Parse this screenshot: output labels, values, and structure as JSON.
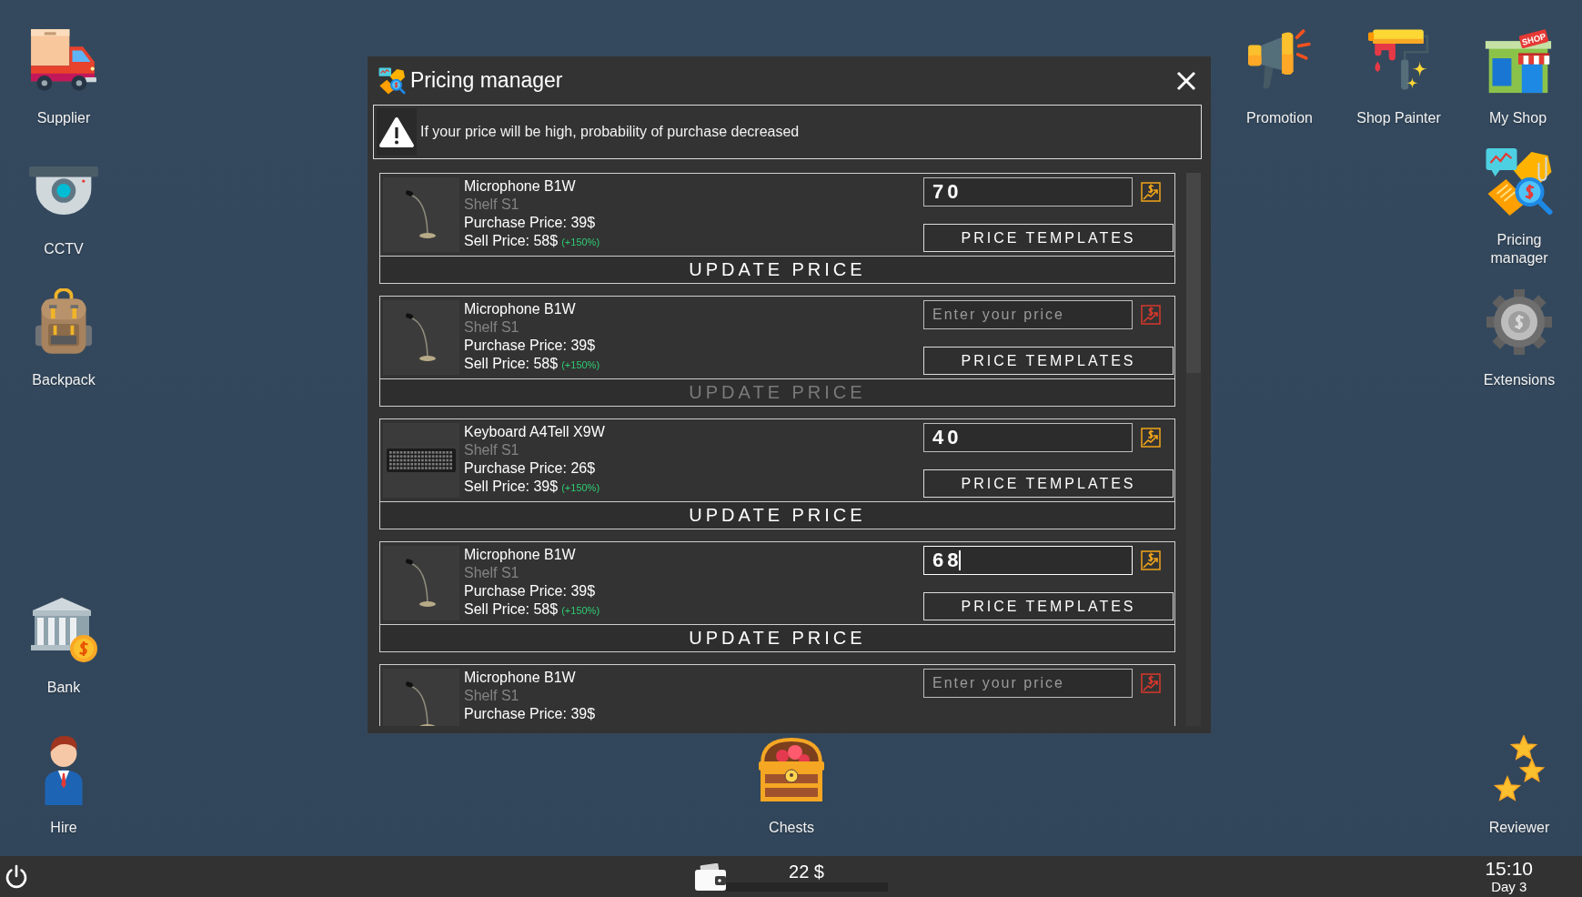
{
  "desktop": {
    "left_column": [
      {
        "label": "Supplier",
        "kind": "truck"
      },
      {
        "label": "CCTV",
        "kind": "camera"
      },
      {
        "label": "Backpack",
        "kind": "backpack"
      }
    ],
    "left_bottom": [
      {
        "label": "Bank",
        "kind": "bank"
      },
      {
        "label": "Hire",
        "kind": "person"
      }
    ],
    "top_right": [
      {
        "label": "Promotion",
        "kind": "megaphone"
      },
      {
        "label": "Shop Painter",
        "kind": "roller"
      },
      {
        "label": "My Shop",
        "kind": "shop",
        "sign": "SHOP"
      }
    ],
    "right_column": [
      {
        "label": "Pricing manager",
        "kind": "pricing"
      },
      {
        "label": "Extensions",
        "kind": "gear"
      }
    ],
    "bottom_center": [
      {
        "label": "Chests",
        "kind": "chest"
      }
    ],
    "bottom_right": [
      {
        "label": "Reviewer",
        "kind": "stars"
      }
    ]
  },
  "window": {
    "title": "Pricing manager",
    "notice": "If your price will be high, probability of purchase decreased",
    "cards": [
      {
        "product": "Microphone B1W",
        "kind": "microphone",
        "shelf": "Shelf S1",
        "purchase_price": "Purchase Price: 39$",
        "sell_price": "Sell Price: 58$",
        "markup": "(+150%)",
        "price": {
          "value": "70",
          "focused": false,
          "alert": false
        },
        "templates_button": "PRICE TEMPLATES",
        "update_button": {
          "label": "UPDATE PRICE",
          "disabled": false
        }
      },
      {
        "product": "Microphone B1W",
        "kind": "microphone",
        "shelf": "Shelf S1",
        "purchase_price": "Purchase Price: 39$",
        "sell_price": "Sell Price: 58$",
        "markup": "(+150%)",
        "price": {
          "placeholder": "Enter your price",
          "focused": false,
          "alert": true
        },
        "templates_button": "PRICE TEMPLATES",
        "update_button": {
          "label": "UPDATE PRICE",
          "disabled": true
        }
      },
      {
        "product": "Keyboard A4Tell X9W",
        "kind": "keyboard",
        "shelf": "Shelf S1",
        "purchase_price": "Purchase Price: 26$",
        "sell_price": "Sell Price: 39$",
        "markup": "(+150%)",
        "price": {
          "value": "40",
          "focused": false,
          "alert": false
        },
        "templates_button": "PRICE TEMPLATES",
        "update_button": {
          "label": "UPDATE PRICE",
          "disabled": false
        }
      },
      {
        "product": "Microphone B1W",
        "kind": "microphone",
        "shelf": "Shelf S1",
        "purchase_price": "Purchase Price: 39$",
        "sell_price": "Sell Price: 58$",
        "markup": "(+150%)",
        "price": {
          "value": "68",
          "focused": true,
          "alert": false
        },
        "templates_button": "PRICE TEMPLATES",
        "update_button": {
          "label": "UPDATE PRICE",
          "disabled": false
        }
      },
      {
        "product": "Microphone B1W",
        "kind": "microphone",
        "shelf": "Shelf S1",
        "purchase_price": "Purchase Price: 39$",
        "price": {
          "placeholder": "Enter your price",
          "focused": false,
          "alert": true
        }
      }
    ]
  },
  "taskbar": {
    "balance": "22 $",
    "clock": "15:10",
    "day": "Day 3"
  }
}
